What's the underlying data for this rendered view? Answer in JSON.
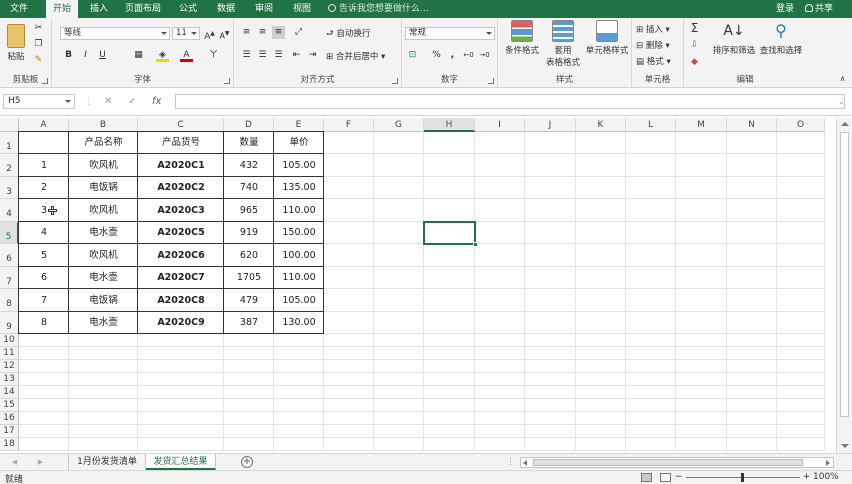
{
  "ribbon_tabs": [
    "文件",
    "开始",
    "插入",
    "页面布局",
    "公式",
    "数据",
    "审阅",
    "视图"
  ],
  "tell_me": "告诉我您想要做什么...",
  "account": {
    "login": "登录",
    "share": "共享"
  },
  "ribbon": {
    "paste": "粘贴",
    "clipboard_label": "剪贴板",
    "font_name": "等线",
    "font_size": "11",
    "font_label": "字体",
    "wrap_text": "自动换行",
    "merge_center": "合并后居中",
    "alignment_label": "对齐方式",
    "number_format": "常规",
    "number_label": "数字",
    "conditional_format": "条件格式",
    "format_as_table_1": "套用",
    "format_as_table_2": "表格格式",
    "cell_styles": "单元格样式",
    "styles_label": "样式",
    "insert": "插入",
    "delete": "删除",
    "format": "格式",
    "cells_label": "单元格",
    "sort_filter": "排序和筛选",
    "find_select": "查找和选择",
    "editing_label": "编辑",
    "bold": "B",
    "italic": "I",
    "underline": "U",
    "font_color_glyph": "A",
    "percent": "%",
    "comma": ","
  },
  "formula_bar": {
    "name_box": "H5",
    "fx": "fx",
    "formula": ""
  },
  "columns": [
    "A",
    "B",
    "C",
    "D",
    "E",
    "F",
    "G",
    "H",
    "I",
    "J",
    "K",
    "L",
    "M",
    "N",
    "O"
  ],
  "rows": [
    "1",
    "2",
    "3",
    "4",
    "5",
    "6",
    "7",
    "8",
    "9",
    "10",
    "11",
    "12",
    "13",
    "14",
    "15",
    "16",
    "17",
    "18"
  ],
  "table": {
    "headers": [
      "",
      "产品名称",
      "产品货号",
      "数量",
      "单价"
    ],
    "rows": [
      [
        "1",
        "吹风机",
        "A2020C1",
        "432",
        "105.00"
      ],
      [
        "2",
        "电饭锅",
        "A2020C2",
        "740",
        "135.00"
      ],
      [
        "3",
        "吹风机",
        "A2020C3",
        "965",
        "110.00"
      ],
      [
        "4",
        "电水壶",
        "A2020C5",
        "919",
        "150.00"
      ],
      [
        "5",
        "吹风机",
        "A2020C6",
        "620",
        "100.00"
      ],
      [
        "6",
        "电水壶",
        "A2020C7",
        "1705",
        "110.00"
      ],
      [
        "7",
        "电饭锅",
        "A2020C8",
        "479",
        "105.00"
      ],
      [
        "8",
        "电水壶",
        "A2020C9",
        "387",
        "130.00"
      ]
    ]
  },
  "selected_cell": "H5",
  "sheets": [
    "1月份发货清单",
    "发货汇总结果"
  ],
  "active_sheet": "发货汇总结果",
  "status": {
    "ready": "就绪",
    "zoom": "100%"
  },
  "colors": {
    "accent": "#217346"
  }
}
